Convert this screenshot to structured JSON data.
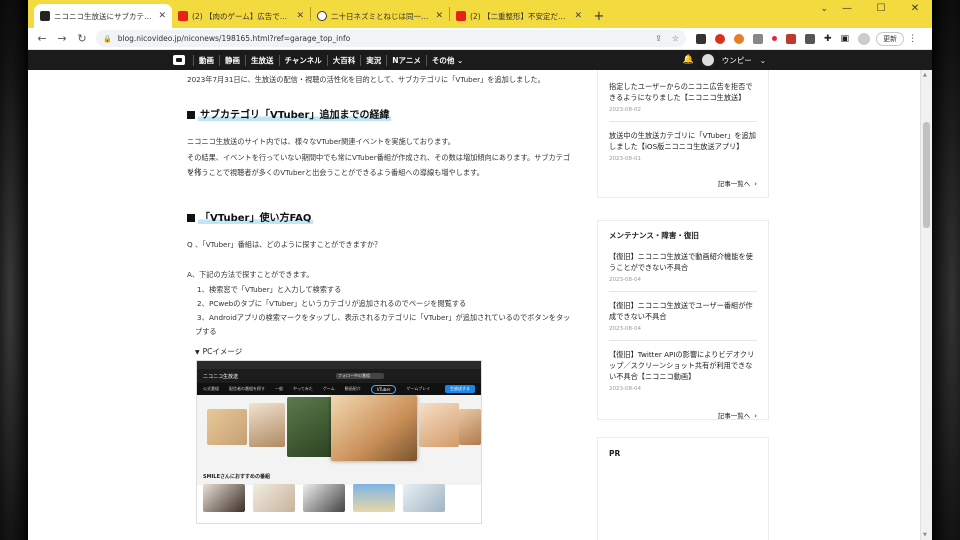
{
  "tabs": [
    {
      "title": "ニコニコ生放送にサブカテゴリ「VTuber」を追加しました",
      "favicon": "niconico-icon",
      "active": true
    },
    {
      "title": "(2) 【肉のゲーム】広告でよく見るやつ",
      "favicon": "youtube-icon",
      "active": false
    },
    {
      "title": "二十日ネズミとねじは同一人物？",
      "favicon": "info-icon",
      "active": false
    },
    {
      "title": "(2) 【二重整形】不安定だった二重が",
      "favicon": "youtube-icon",
      "active": false
    }
  ],
  "new_tab_label": "+",
  "window_controls": {
    "search": "⌄",
    "minimize": "—",
    "maximize": "☐",
    "close": "✕"
  },
  "toolbar": {
    "back": "←",
    "forward": "→",
    "reload": "↻",
    "url": "blog.nicovideo.jp/niconews/198165.html?ref=garage_top_info",
    "update_label": "更新",
    "menu": "⋮"
  },
  "site_nav": {
    "items": [
      "動画",
      "静画",
      "生放送",
      "チャンネル",
      "大百科",
      "実況",
      "Nアニメ",
      "その他 ⌄"
    ],
    "user_name": "ウンピー",
    "user_chevron": "⌄"
  },
  "article": {
    "lead": "2023年7月31日に、生放送の配信・視聴の活性化を目的として、サブカテゴリに「VTuber」を追加しました。",
    "heading1": "サブカテゴリ「VTuber」追加までの経緯",
    "para1_line1": "ニコニコ生放送のサイト内では、様々なVTuber関連イベントを実施しております。",
    "para1_line2": "その結果、イベントを行っていない期間中でも常にVTuber番組が作成され、その数は増加傾向にあります。サブカテゴリ化",
    "para1_line3": "を行うことで視聴者が多くのVTuberと出会うことができるよう番組への導線も増やします。",
    "heading2": "「VTuber」使い方FAQ",
    "q": "Q 、「VTuber」番組は、どのように探すことができますか？",
    "a": "A、下記の方法で探すことができます。",
    "steps": [
      "検索窓で「VTuber」と入力して検索する",
      "PCwebのタブに「VTuber」というカテゴリが追加されるのでページを閲覧する",
      "Androidアプリの検索マークをタップし、表示されるカテゴリに「VTuber」が追加されているのでボタンをタップする"
    ],
    "pc_caption": "PCイメージ",
    "screenshot": {
      "logo": "ニコニコ生放送",
      "search_placeholder": "フォロー中の番組",
      "categories": [
        "公式番組",
        "配信者の番組を探す",
        "一般",
        "やってみた",
        "ゲーム",
        "動画紹介",
        "VTuber",
        "ゲームプレイ",
        "踊ってみた"
      ],
      "vtuber_tab": "VTuber",
      "live_button": "生放送する",
      "rec_title": "SMILEさんにおすすめの番組"
    }
  },
  "sidebar": {
    "box1": {
      "items": [
        {
          "title": "指定したユーザーからのニコニ広告を拒否できるようになりました【ニコニコ生放送】",
          "date": "2023-08-02"
        },
        {
          "title": "放送中の生放送カテゴリに「VTuber」を追加しました【iOS版ニコニコ生放送アプリ】",
          "date": "2023-08-01"
        }
      ],
      "more": "記事一覧へ"
    },
    "box2": {
      "heading": "メンテナンス・障害・復旧",
      "items": [
        {
          "title": "【復旧】ニコニコ生放送で動画紹介機能を使うことができない不具合",
          "date": "2023-08-04"
        },
        {
          "title": "【復旧】ニコニコ生放送でユーザー番組が作成できない不具合",
          "date": "2023-08-04"
        },
        {
          "title": "【復旧】Twitter APIの影響によりビデオクリップ／スクリーンショット共有が利用できない不具合【ニコニコ動画】",
          "date": "2023-08-04"
        }
      ],
      "more": "記事一覧へ"
    },
    "box3": {
      "heading": "PR"
    }
  },
  "colors": {
    "tabstrip": "#f3da3f",
    "sitenav": "#1b1b1b",
    "highlight": "#bfe6f6",
    "youtube": "#e62117"
  }
}
